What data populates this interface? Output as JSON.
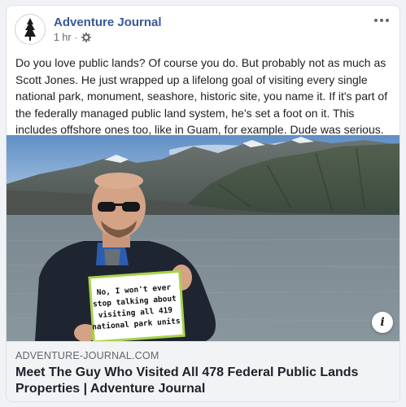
{
  "post": {
    "page_name": "Adventure Journal",
    "timestamp": "1 hr",
    "separator": "·",
    "privacy_icon": "globe-gear-icon",
    "more_icon": "more-options-icon",
    "text": "Do you love public lands? Of course you do. But probably not as much as Scott Jones. He just wrapped up a lifelong goal of visiting every single national park, monument, seashore, historic site, you name it. If it's part of the federally managed public land system, he's set a foot on it. This includes offshore ones too, like in Guam, for example. Dude was serious."
  },
  "photo": {
    "sign_lines": [
      "No, I won't ever",
      "stop talking about",
      "visiting all 419",
      "national park units"
    ],
    "info_label": "i"
  },
  "link_preview": {
    "domain": "ADVENTURE-JOURNAL.COM",
    "title": "Meet The Guy Who Visited All 478 Federal Public Lands Properties | Adventure Journal"
  },
  "colors": {
    "page_name": "#385898",
    "meta": "#65676b",
    "preview_bg": "#f2f3f5"
  }
}
